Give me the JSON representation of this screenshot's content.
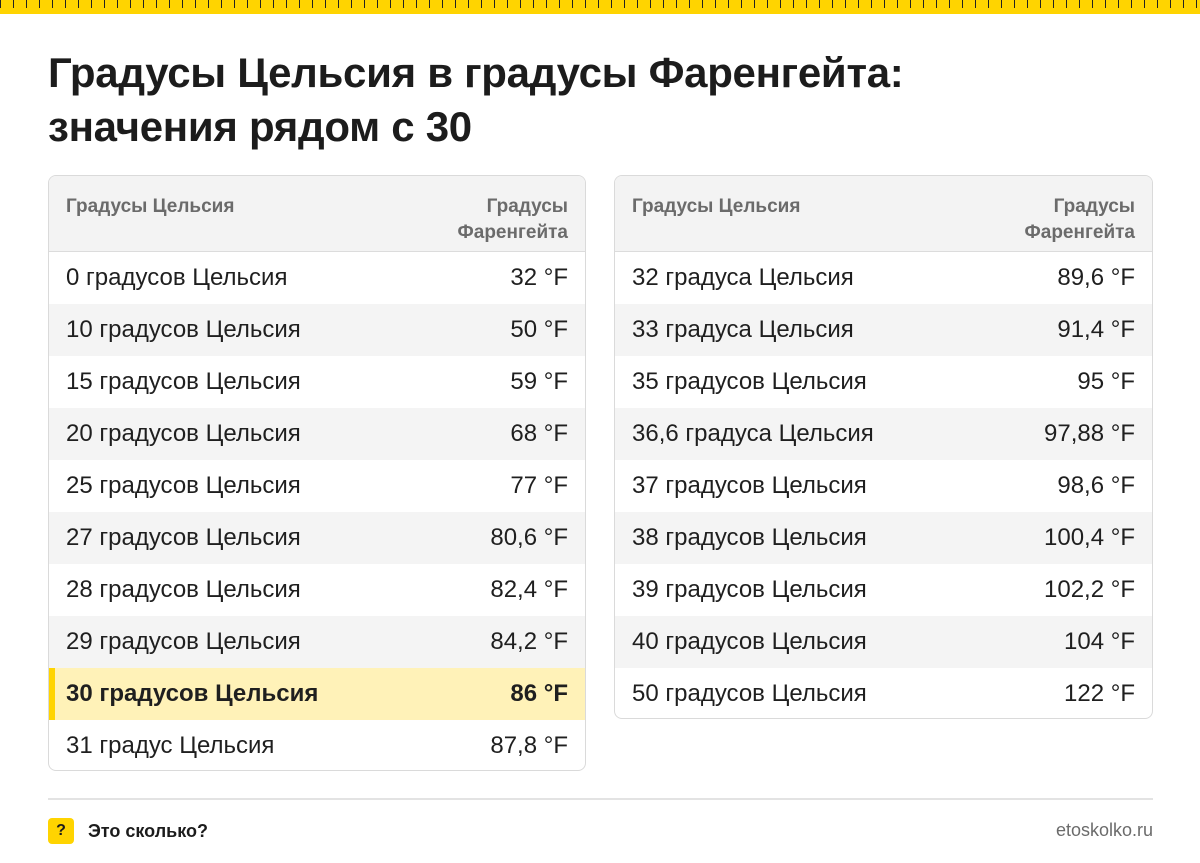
{
  "title": {
    "line1": "Градусы Цельсия в градусы Фаренгейта:",
    "line2": "значения рядом с 30"
  },
  "left_table": {
    "header_celsius": "Градусы Цельсия",
    "header_fahrenheit_1": "Градусы",
    "header_fahrenheit_2": "Фаренгейта",
    "rows": [
      {
        "c": "0 градусов Цельсия",
        "f": "32 °F"
      },
      {
        "c": "10 градусов Цельсия",
        "f": "50 °F"
      },
      {
        "c": "15 градусов Цельсия",
        "f": "59 °F"
      },
      {
        "c": "20 градусов Цельсия",
        "f": "68 °F"
      },
      {
        "c": "25 градусов Цельсия",
        "f": "77 °F"
      },
      {
        "c": "27 градусов Цельсия",
        "f": "80,6 °F"
      },
      {
        "c": "28 градусов Цельсия",
        "f": "82,4 °F"
      },
      {
        "c": "29 градусов Цельсия",
        "f": "84,2 °F"
      },
      {
        "c": "30 градусов Цельсия",
        "f": "86 °F"
      },
      {
        "c": "31 градус Цельсия",
        "f": "87,8 °F"
      }
    ]
  },
  "right_table": {
    "header_celsius": "Градусы Цельсия",
    "header_fahrenheit_1": "Градусы",
    "header_fahrenheit_2": "Фаренгейта",
    "rows": [
      {
        "c": "32 градуса Цельсия",
        "f": "89,6 °F"
      },
      {
        "c": "33 градуса Цельсия",
        "f": "91,4 °F"
      },
      {
        "c": "35 градусов Цельсия",
        "f": "95 °F"
      },
      {
        "c": "36,6 градуса Цельсия",
        "f": "97,88 °F"
      },
      {
        "c": "37 градусов Цельсия",
        "f": "98,6 °F"
      },
      {
        "c": "38 градусов Цельсия",
        "f": "100,4 °F"
      },
      {
        "c": "39 градусов Цельсия",
        "f": "102,2 °F"
      },
      {
        "c": "40 градусов Цельсия",
        "f": "104 °F"
      },
      {
        "c": "50 градусов Цельсия",
        "f": "122 °F"
      }
    ]
  },
  "footer": {
    "icon_glyph": "?",
    "brand": "Это сколько?",
    "site": "etoskolko.ru"
  },
  "colors": {
    "accent_yellow": "#ffd400",
    "highlight_row": "#fff2b8"
  }
}
